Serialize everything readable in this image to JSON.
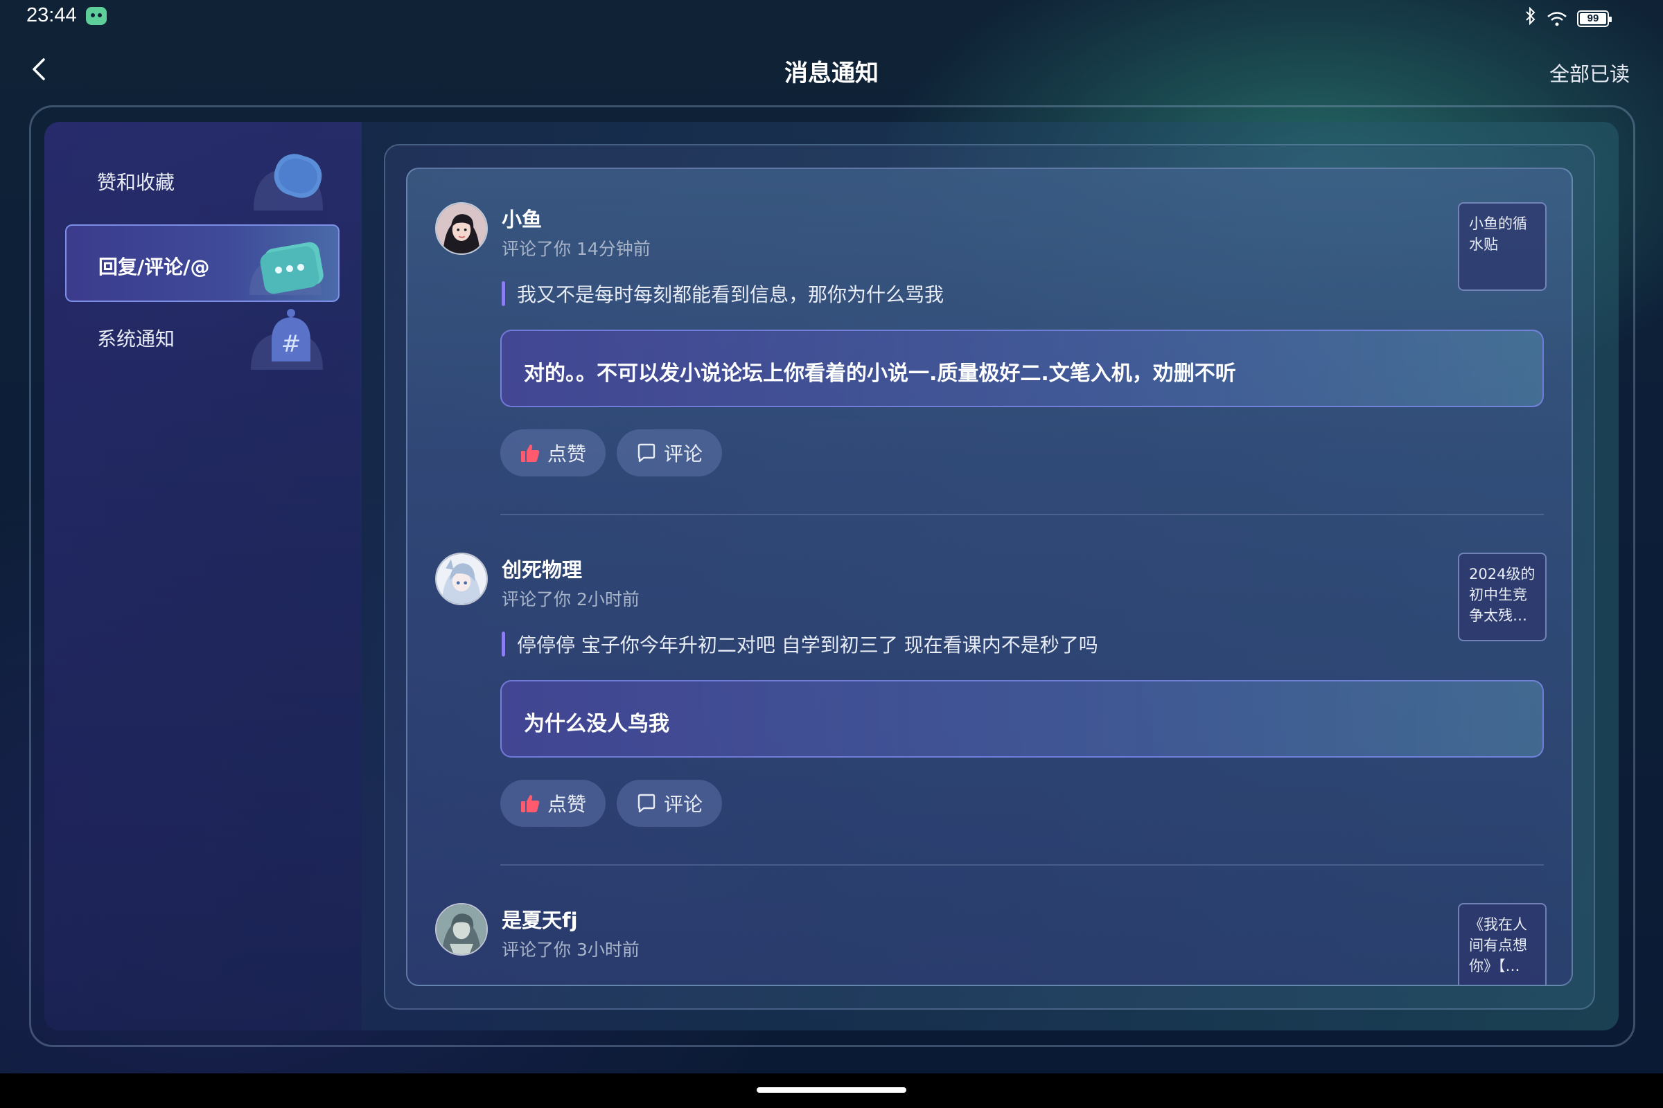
{
  "status_bar": {
    "time": "23:44",
    "app_icon": "android-robot-icon",
    "icons": [
      "bluetooth-icon",
      "wifi-icon",
      "battery-icon"
    ],
    "battery_level": "99"
  },
  "header": {
    "back_icon": "chevron-left-icon",
    "title": "消息通知",
    "mark_all_read": "全部已读"
  },
  "sidebar": {
    "items": [
      {
        "label": "赞和收藏",
        "icon": "heart-bubble-icon",
        "active": false
      },
      {
        "label": "回复/评论/@",
        "icon": "chat-bubble-icon",
        "active": true
      },
      {
        "label": "系统通知",
        "icon": "bell-hash-icon",
        "active": false
      }
    ]
  },
  "notices": [
    {
      "user": "小鱼",
      "meta": "评论了你 14分钟前",
      "quote": "我又不是每时每刻都能看到信息，那你为什么骂我",
      "reply": "对的。。不可以发小说论坛上你看着的小说一.质量极好二.文笔入机，劝删不听",
      "like_label": "点赞",
      "comment_label": "评论",
      "source": "小鱼的循水贴"
    },
    {
      "user": "创死物理",
      "meta": "评论了你 2小时前",
      "quote": "停停停 宝子你今年升初二对吧 自学到初三了 现在看课内不是秒了吗",
      "reply": "为什么没人鸟我",
      "like_label": "点赞",
      "comment_label": "评论",
      "source": "2024级的初中生竞争太残…"
    },
    {
      "user": "是夏天fj",
      "meta": "评论了你 3小时前",
      "source": "《我在人间有点想你》【…"
    }
  ],
  "colors": {
    "accent": "#8a7ef0",
    "like_icon": "#ff5a6e",
    "active_border": "#7d8ee8"
  }
}
